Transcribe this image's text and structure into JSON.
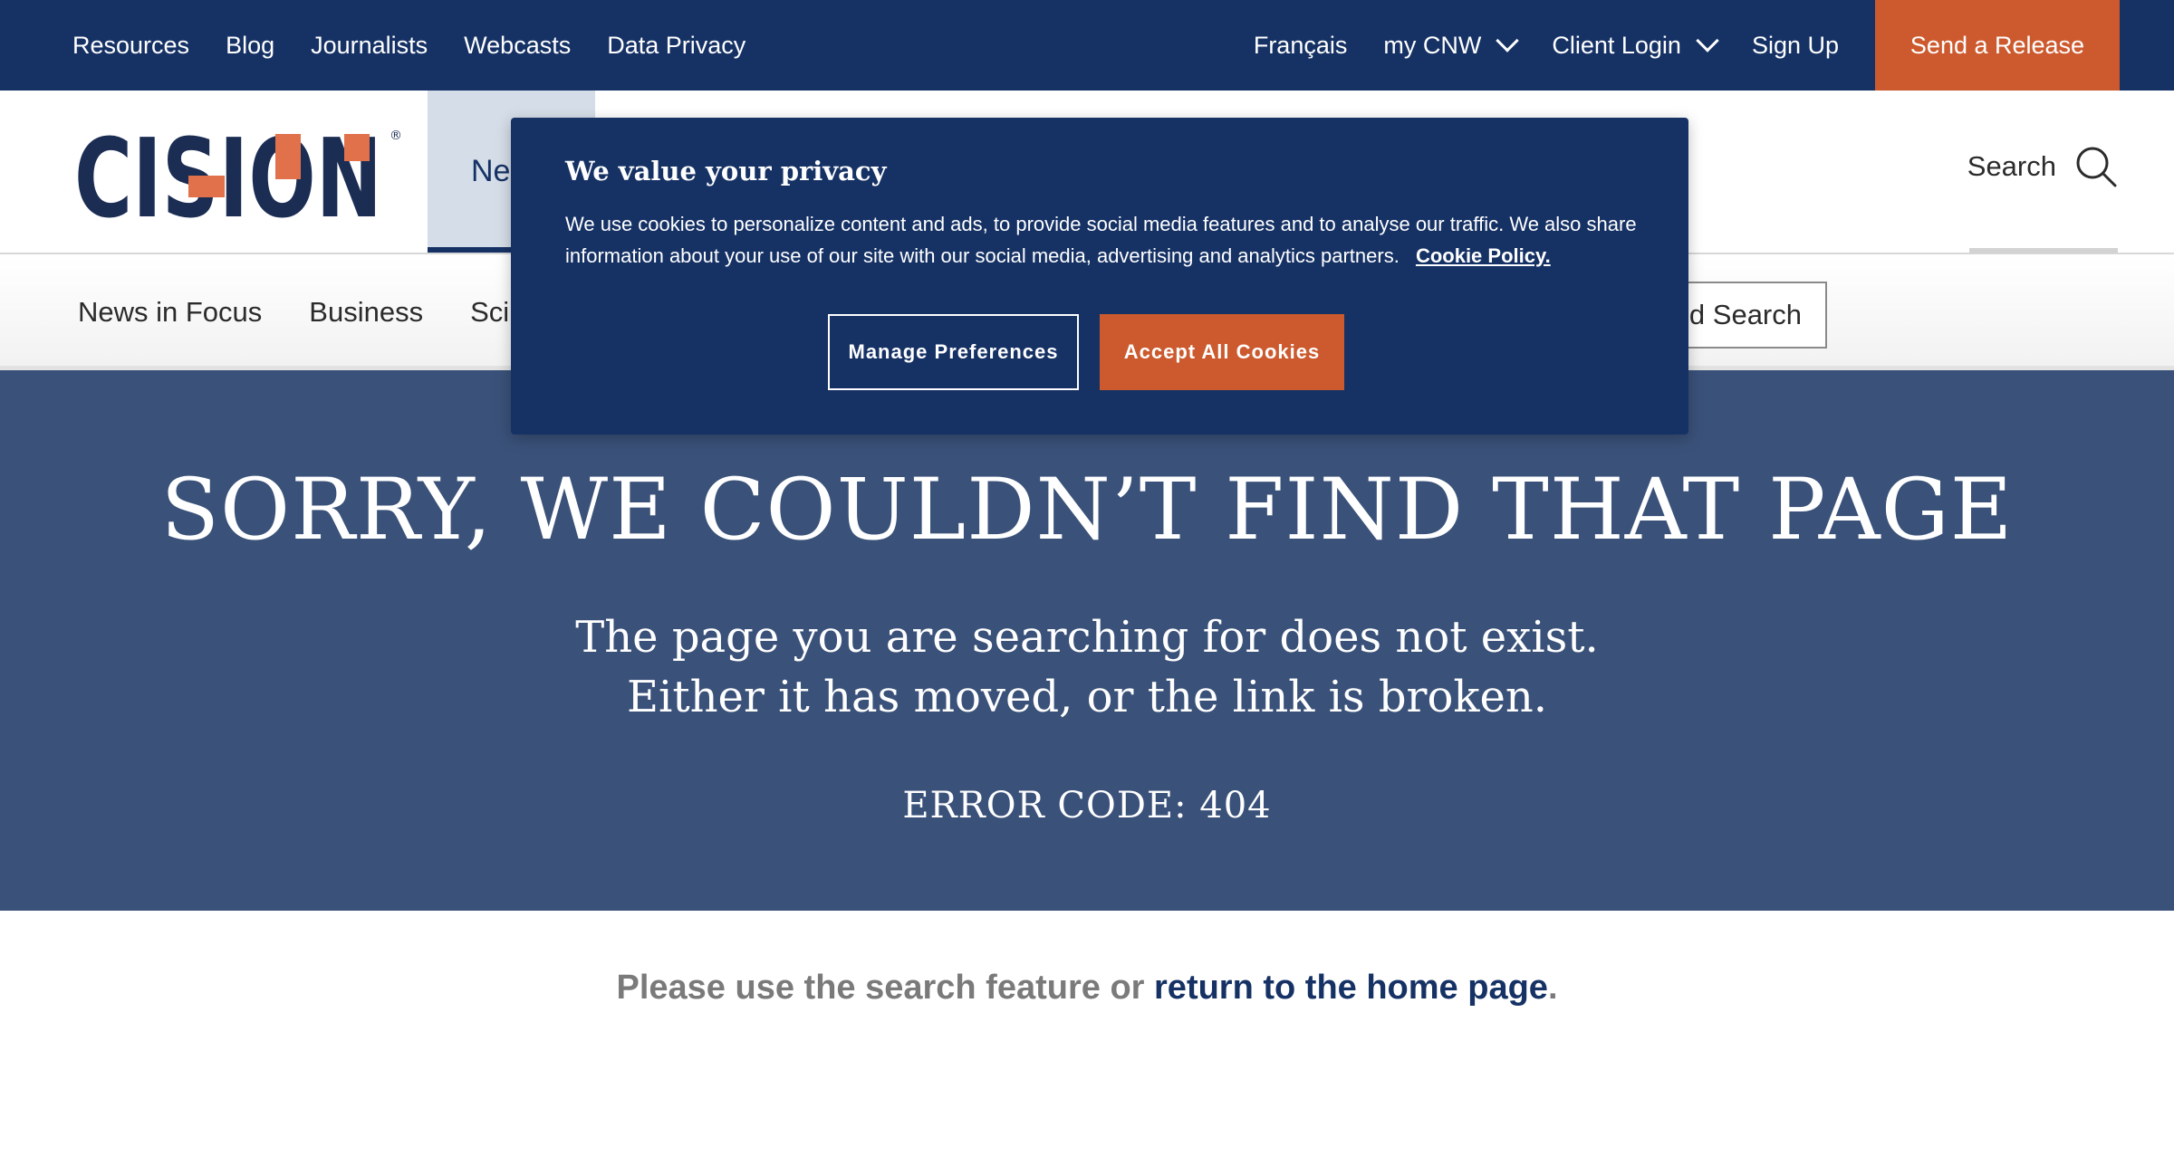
{
  "topbar": {
    "left_links": [
      "Resources",
      "Blog",
      "Journalists",
      "Webcasts",
      "Data Privacy"
    ],
    "language": "Français",
    "my_cnw": "my CNW",
    "client_login": "Client Login",
    "sign_up": "Sign Up",
    "send_release": "Send a Release"
  },
  "header": {
    "logo_text": "CISION",
    "logo_mark": "®",
    "news_tab": "Ne",
    "search_label": "Search"
  },
  "catnav": {
    "items": [
      "News in Focus",
      "Business",
      "Sci"
    ],
    "advanced_search": "d Search"
  },
  "error": {
    "title": "SORRY, WE COULDN’T FIND THAT PAGE",
    "line1": "The page you are searching for does not exist.",
    "line2": "Either it has moved, or the link is broken.",
    "code": "ERROR CODE: 404"
  },
  "note": {
    "prefix": "Please use the search feature or",
    "link": "return to the home page",
    "suffix": "."
  },
  "cookie_banner": {
    "title": "We value your privacy",
    "body": "We use cookies to personalize content and ads, to provide social media features and to analyse our traffic. We also share information about your use of our site with our social media, advertising and analytics partners.",
    "policy_link": "Cookie Policy.",
    "manage_button": "Manage Preferences",
    "accept_button": "Accept All Cookies"
  },
  "colors": {
    "navy": "#163265",
    "orange": "#cc5a2e",
    "hero_bg": "#3a5179"
  }
}
